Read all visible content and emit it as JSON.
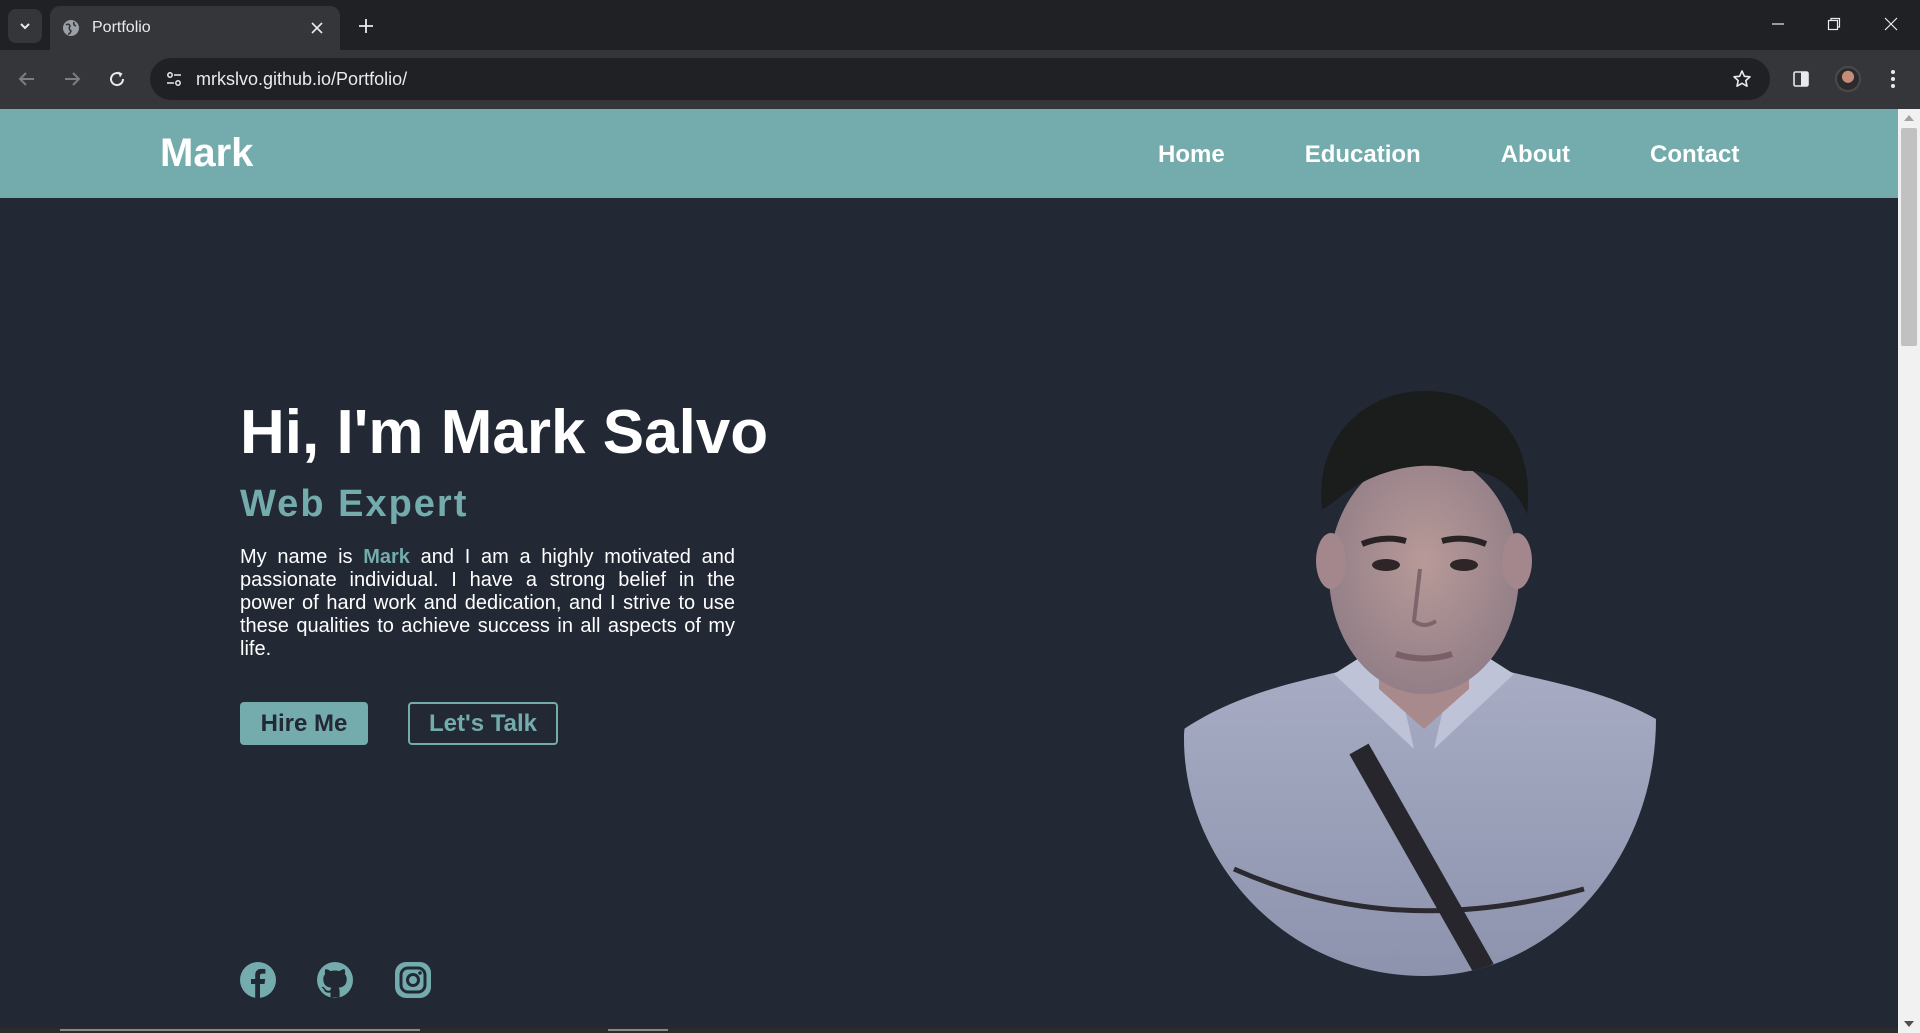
{
  "browser": {
    "tab_title": "Portfolio",
    "url": "mrkslvo.github.io/Portfolio/"
  },
  "site": {
    "logo": "Mark",
    "nav": [
      "Home",
      "Education",
      "About",
      "Contact"
    ]
  },
  "hero": {
    "title": "Hi, I'm Mark Salvo",
    "role": "Web Expert",
    "bio_before": "My name is ",
    "bio_highlight": "Mark",
    "bio_after": " and I am a highly motivated and passionate individual. I have a strong belief in the power of hard work and dedication, and I strive to use these qualities to achieve success in all aspects of my life.",
    "hire_button": "Hire Me",
    "talk_button": "Let's Talk"
  },
  "social": [
    "facebook-icon",
    "github-icon",
    "instagram-icon"
  ],
  "colors": {
    "accent": "#74abad",
    "page_background": "#222834",
    "text": "#ffffff"
  }
}
